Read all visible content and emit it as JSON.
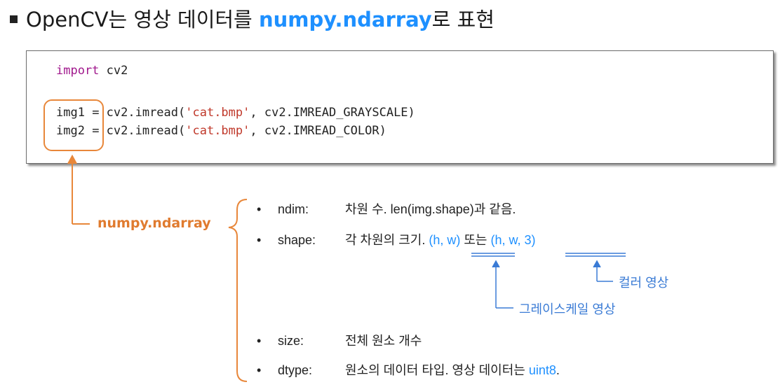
{
  "title": {
    "prefix": "OpenCV는 영상 데이터를 ",
    "highlight": "numpy.ndarray",
    "suffix": "로 표현"
  },
  "code": {
    "line1_kw": "import",
    "line1_rest": " cv2",
    "line2_var": "img1",
    "line2_pre": " = cv2.imread(",
    "line2_str": "'cat.bmp'",
    "line2_post": ", cv2.IMREAD_GRAYSCALE)",
    "line3_var": "img2",
    "line3_pre": " = cv2.imread(",
    "line3_str": "'cat.bmp'",
    "line3_post": ", cv2.IMREAD_COLOR)"
  },
  "callout_label": "numpy.ndarray",
  "bullet_char": "•",
  "attributes": [
    {
      "key": "ndim:",
      "text": "차원 수. len(img.shape)과 같음."
    },
    {
      "key": "shape:",
      "text": "각 차원의 크기. ",
      "v1": "(h, w)",
      "mid": " 또는 ",
      "v2": "(h, w, 3)"
    },
    {
      "key": "size:",
      "text": "전체 원소 개수"
    },
    {
      "key": "dtype:",
      "text": "원소의 데이터 타입. 영상 데이터는 ",
      "v1": "uint8",
      "end": "."
    }
  ],
  "notes": {
    "color": "컬러 영상",
    "gray": "그레이스케일 영상"
  },
  "colors": {
    "accent_blue": "#1e90ff",
    "accent_orange": "#e8873a",
    "keyword": "#a0178c",
    "string": "#c0392b"
  }
}
